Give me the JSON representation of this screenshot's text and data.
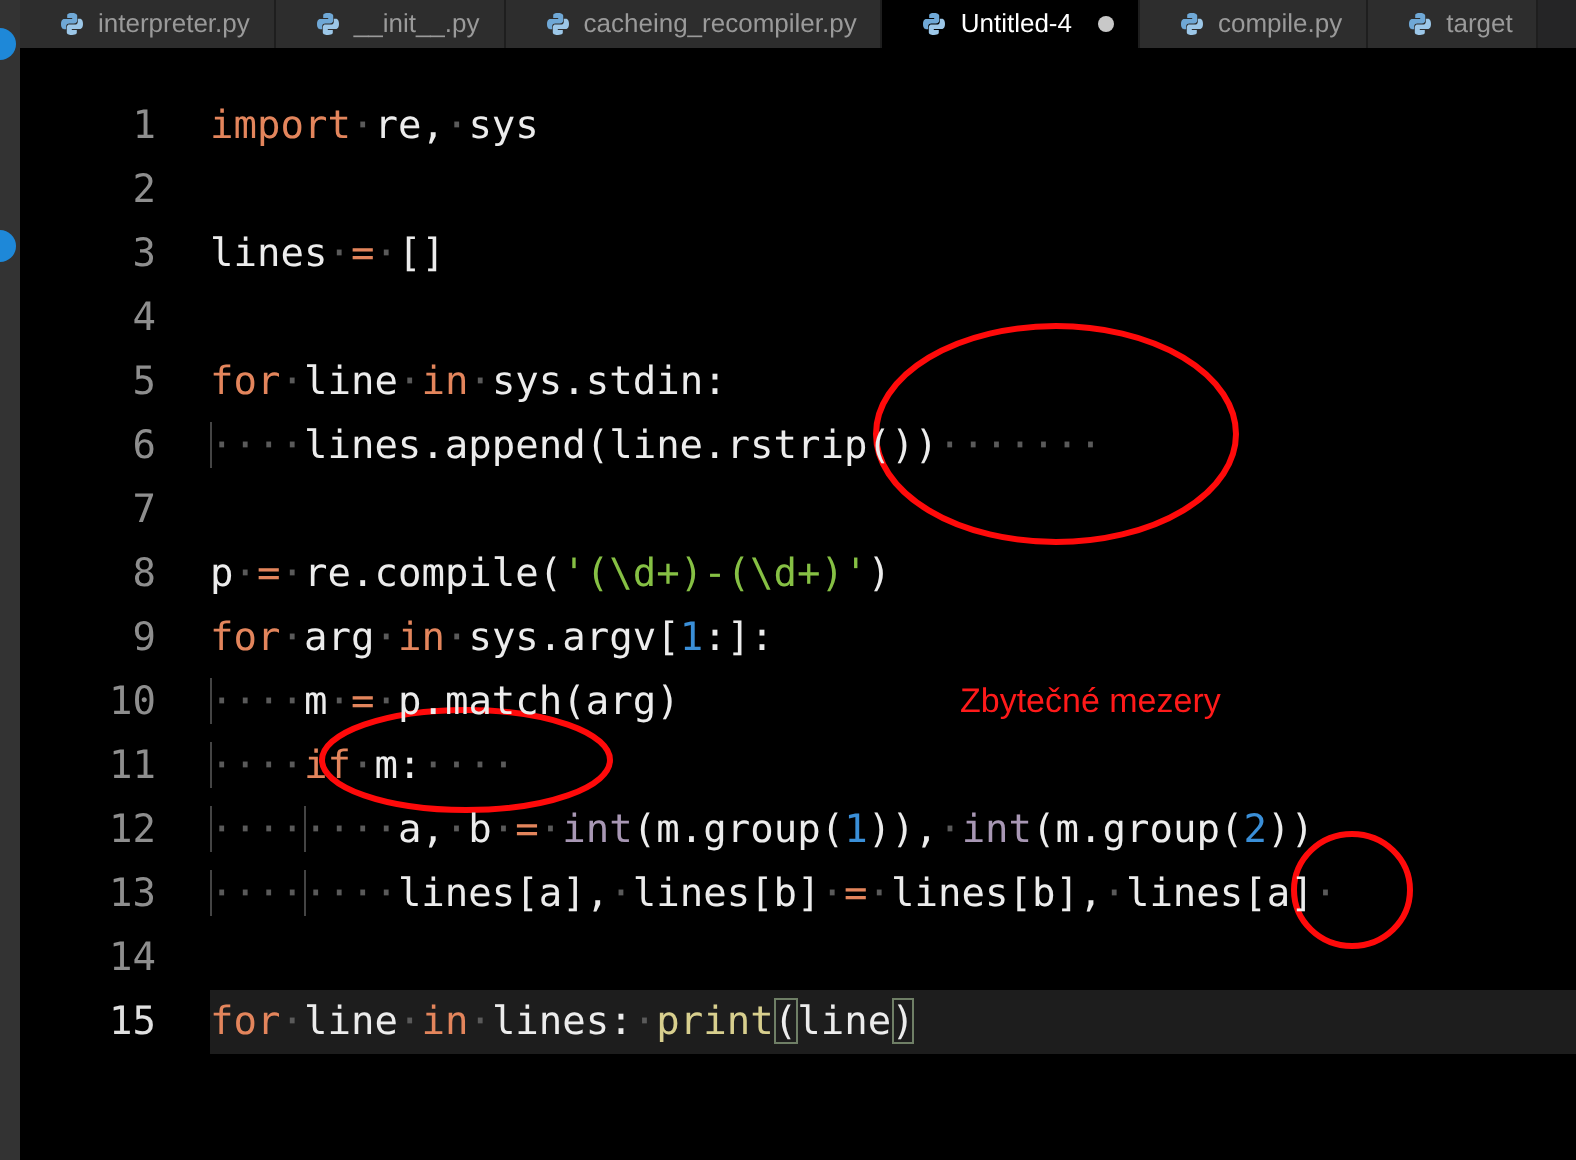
{
  "tabs": [
    {
      "label": "interpreter.py",
      "selected": false,
      "modified": false
    },
    {
      "label": "__init__.py",
      "selected": false,
      "modified": false
    },
    {
      "label": "cacheing_recompiler.py",
      "selected": false,
      "modified": false
    },
    {
      "label": "Untitled-4",
      "selected": true,
      "modified": true
    },
    {
      "label": "compile.py",
      "selected": false,
      "modified": false
    },
    {
      "label": "target",
      "selected": false,
      "modified": false
    }
  ],
  "editor": {
    "lines": [
      {
        "number": "1",
        "current": false,
        "tokens": [
          {
            "kind": "keyword",
            "text": "import"
          },
          {
            "kind": "space",
            "text": "·"
          },
          {
            "kind": "plain",
            "text": "re,"
          },
          {
            "kind": "space",
            "text": "·"
          },
          {
            "kind": "plain",
            "text": "sys"
          }
        ]
      },
      {
        "number": "2",
        "current": false
      },
      {
        "number": "3",
        "current": false,
        "tokens": [
          {
            "kind": "plain",
            "text": "lines"
          },
          {
            "kind": "space",
            "text": "·"
          },
          {
            "kind": "keyword",
            "text": "="
          },
          {
            "kind": "space",
            "text": "·"
          },
          {
            "kind": "plain",
            "text": "[]"
          }
        ]
      },
      {
        "number": "4",
        "current": false
      },
      {
        "number": "5",
        "current": false,
        "tokens": [
          {
            "kind": "keyword",
            "text": "for"
          },
          {
            "kind": "space",
            "text": "·"
          },
          {
            "kind": "plain",
            "text": "line"
          },
          {
            "kind": "space",
            "text": "·"
          },
          {
            "kind": "keyword",
            "text": "in"
          },
          {
            "kind": "space",
            "text": "·"
          },
          {
            "kind": "plain",
            "text": "sys.stdin:"
          }
        ]
      },
      {
        "number": "6",
        "current": false,
        "tokens": [
          {
            "kind": "indent",
            "text": "····"
          },
          {
            "kind": "plain",
            "text": "lines.append(line.rstrip())"
          },
          {
            "kind": "space",
            "text": "·······"
          }
        ]
      },
      {
        "number": "7",
        "current": false
      },
      {
        "number": "8",
        "current": false,
        "tokens": [
          {
            "kind": "plain",
            "text": "p"
          },
          {
            "kind": "space",
            "text": "·"
          },
          {
            "kind": "keyword",
            "text": "="
          },
          {
            "kind": "space",
            "text": "·"
          },
          {
            "kind": "plain",
            "text": "re.compile("
          },
          {
            "kind": "string",
            "text": "'(\\d+)-(\\d+)'"
          },
          {
            "kind": "plain",
            "text": ")"
          }
        ]
      },
      {
        "number": "9",
        "current": false,
        "tokens": [
          {
            "kind": "keyword",
            "text": "for"
          },
          {
            "kind": "space",
            "text": "·"
          },
          {
            "kind": "plain",
            "text": "arg"
          },
          {
            "kind": "space",
            "text": "·"
          },
          {
            "kind": "keyword",
            "text": "in"
          },
          {
            "kind": "space",
            "text": "·"
          },
          {
            "kind": "plain",
            "text": "sys.argv["
          },
          {
            "kind": "number",
            "text": "1"
          },
          {
            "kind": "plain",
            "text": ":]:"
          }
        ]
      },
      {
        "number": "10",
        "current": false,
        "tokens": [
          {
            "kind": "indent",
            "text": "····"
          },
          {
            "kind": "plain",
            "text": "m"
          },
          {
            "kind": "space",
            "text": "·"
          },
          {
            "kind": "keyword",
            "text": "="
          },
          {
            "kind": "space",
            "text": "·"
          },
          {
            "kind": "plain",
            "text": "p.match(arg)"
          }
        ]
      },
      {
        "number": "11",
        "current": false,
        "tokens": [
          {
            "kind": "indent",
            "text": "····"
          },
          {
            "kind": "keyword",
            "text": "if"
          },
          {
            "kind": "space",
            "text": "·"
          },
          {
            "kind": "plain",
            "text": "m:"
          },
          {
            "kind": "space",
            "text": "····"
          }
        ]
      },
      {
        "number": "12",
        "current": false,
        "tokens": [
          {
            "kind": "indent",
            "text": "····"
          },
          {
            "kind": "indent",
            "text": "····"
          },
          {
            "kind": "plain",
            "text": "a,"
          },
          {
            "kind": "space",
            "text": "·"
          },
          {
            "kind": "plain",
            "text": "b"
          },
          {
            "kind": "space",
            "text": "·"
          },
          {
            "kind": "keyword",
            "text": "="
          },
          {
            "kind": "space",
            "text": "·"
          },
          {
            "kind": "builtin",
            "text": "int"
          },
          {
            "kind": "plain",
            "text": "(m.group("
          },
          {
            "kind": "number",
            "text": "1"
          },
          {
            "kind": "plain",
            "text": ")),"
          },
          {
            "kind": "space",
            "text": "·"
          },
          {
            "kind": "builtin",
            "text": "int"
          },
          {
            "kind": "plain",
            "text": "(m.group("
          },
          {
            "kind": "number",
            "text": "2"
          },
          {
            "kind": "plain",
            "text": "))"
          }
        ]
      },
      {
        "number": "13",
        "current": false,
        "tokens": [
          {
            "kind": "indent",
            "text": "····"
          },
          {
            "kind": "indent",
            "text": "····"
          },
          {
            "kind": "plain",
            "text": "lines[a],"
          },
          {
            "kind": "space",
            "text": "·"
          },
          {
            "kind": "plain",
            "text": "lines[b]"
          },
          {
            "kind": "space",
            "text": "·"
          },
          {
            "kind": "keyword",
            "text": "="
          },
          {
            "kind": "space",
            "text": "·"
          },
          {
            "kind": "plain",
            "text": "lines[b],"
          },
          {
            "kind": "space",
            "text": "·"
          },
          {
            "kind": "plain",
            "text": "lines[a]"
          },
          {
            "kind": "space",
            "text": "·"
          }
        ]
      },
      {
        "number": "14",
        "current": false
      },
      {
        "number": "15",
        "current": true,
        "tokens": [
          {
            "kind": "keyword",
            "text": "for"
          },
          {
            "kind": "space",
            "text": "·"
          },
          {
            "kind": "plain",
            "text": "line"
          },
          {
            "kind": "space",
            "text": "·"
          },
          {
            "kind": "keyword",
            "text": "in"
          },
          {
            "kind": "space",
            "text": "·"
          },
          {
            "kind": "plain",
            "text": "lines:"
          },
          {
            "kind": "space",
            "text": "·"
          },
          {
            "kind": "function",
            "text": "print"
          },
          {
            "kind": "bracket",
            "text": "("
          },
          {
            "kind": "plain",
            "text": "line"
          },
          {
            "kind": "bracket",
            "text": ")"
          }
        ]
      }
    ]
  },
  "annotation": {
    "note": "Zbytečné mezery"
  }
}
